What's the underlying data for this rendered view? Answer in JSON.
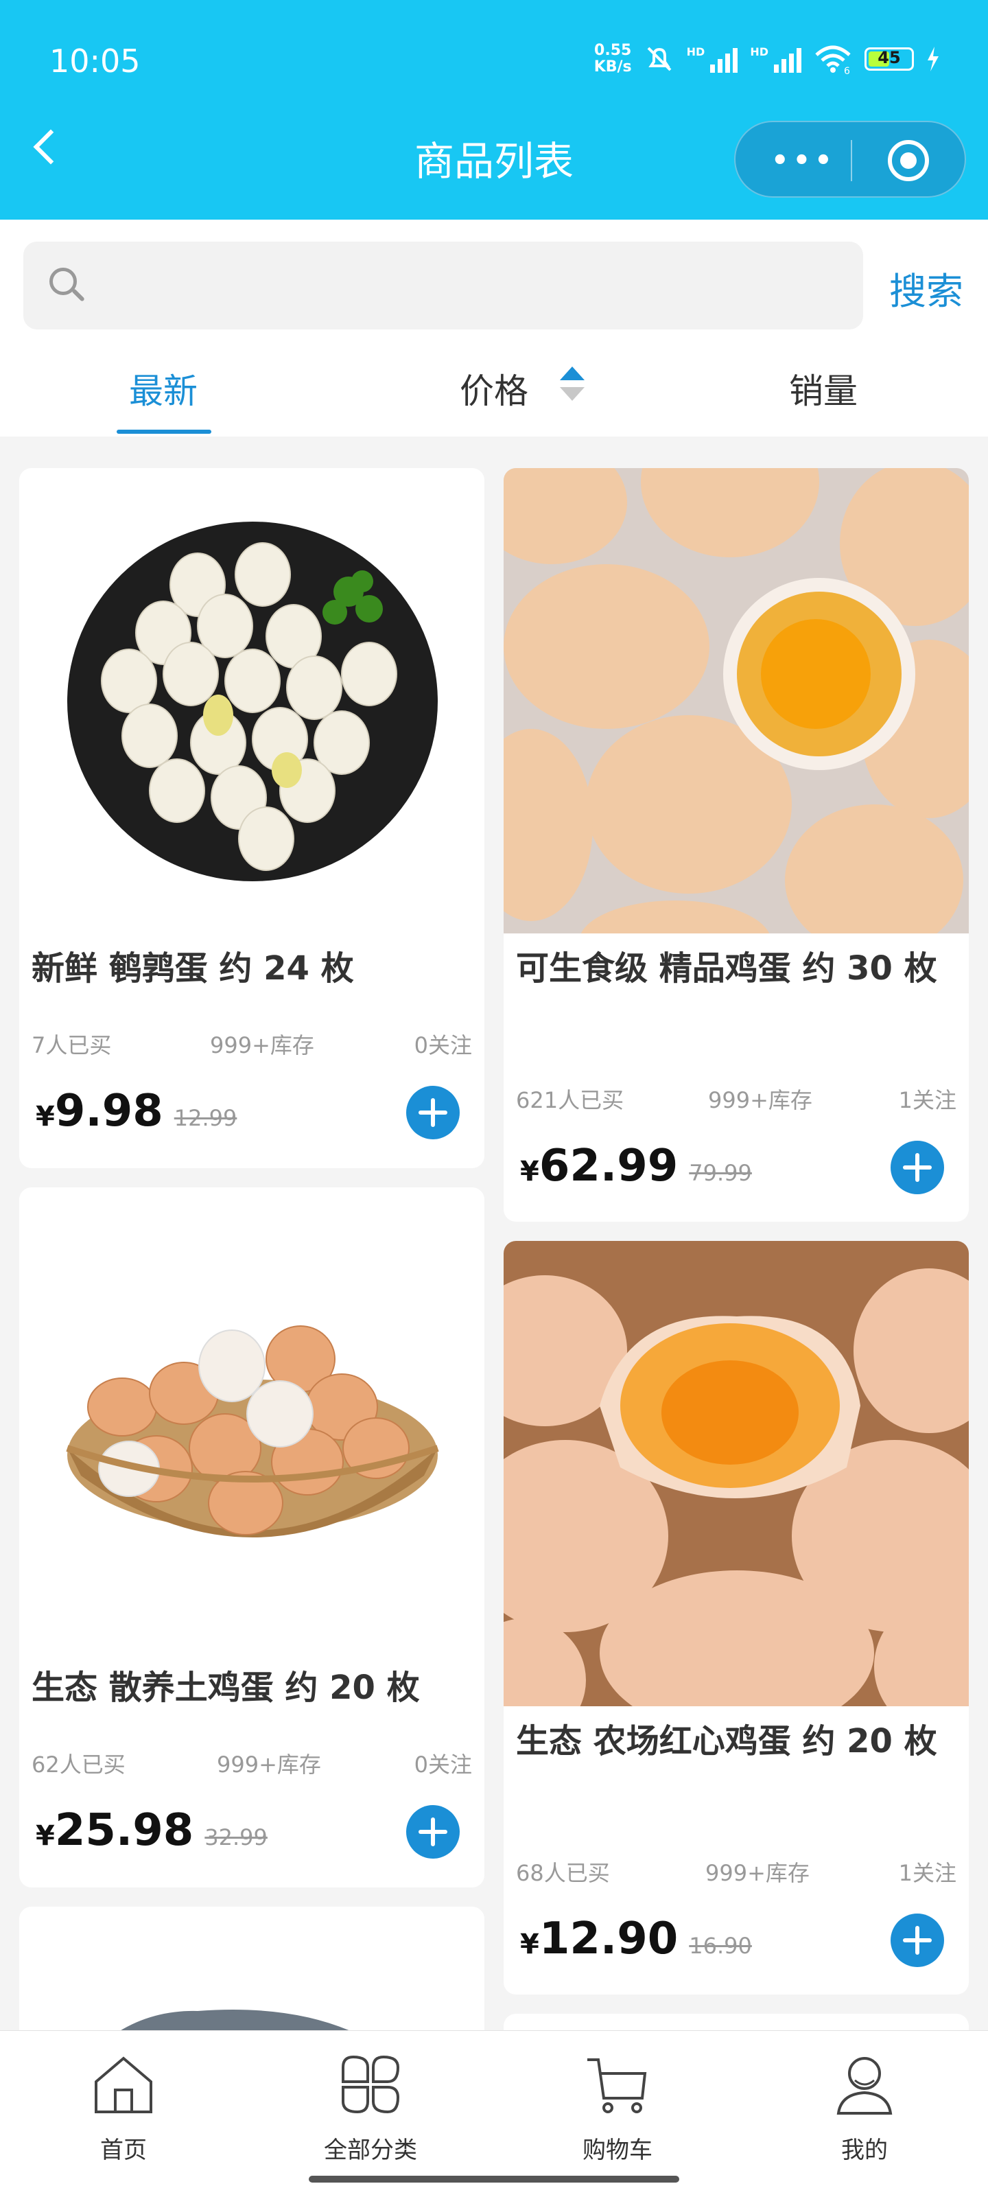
{
  "status_bar": {
    "time": "10:05",
    "net_speed_value": "0.55",
    "net_speed_unit": "KB/s",
    "signal_1_tag": "HD",
    "signal_2_tag": "HD",
    "wifi_tag": "6",
    "battery": "45"
  },
  "nav": {
    "title": "商品列表",
    "more_icon": "more-dots-icon",
    "close_icon": "target-icon"
  },
  "search": {
    "placeholder": "",
    "value": "",
    "button_label": "搜索"
  },
  "sort_tabs": [
    {
      "label": "最新",
      "active": true
    },
    {
      "label": "价格",
      "active": false
    },
    {
      "label": "销量",
      "active": false
    }
  ],
  "products": [
    {
      "name": "新鲜 鹌鹑蛋 约 24 枚",
      "bought": "7人已买",
      "stock": "999+库存",
      "follow": "0关注",
      "currency": "¥",
      "price": "9.98",
      "original_price": "12.99"
    },
    {
      "name": "可生食级 精品鸡蛋 约 30 枚",
      "bought": "621人已买",
      "stock": "999+库存",
      "follow": "1关注",
      "currency": "¥",
      "price": "62.99",
      "original_price": "79.99"
    },
    {
      "name": "生态 散养土鸡蛋 约 20 枚",
      "bought": "62人已买",
      "stock": "999+库存",
      "follow": "0关注",
      "currency": "¥",
      "price": "25.98",
      "original_price": "32.99"
    },
    {
      "name": "生态 农场红心鸡蛋 约 20 枚",
      "bought": "68人已买",
      "stock": "999+库存",
      "follow": "1关注",
      "currency": "¥",
      "price": "12.90",
      "original_price": "16.90"
    }
  ],
  "tabbar": [
    {
      "label": "首页",
      "icon": "home-icon"
    },
    {
      "label": "全部分类",
      "icon": "category-icon"
    },
    {
      "label": "购物车",
      "icon": "cart-icon"
    },
    {
      "label": "我的",
      "icon": "user-icon"
    }
  ],
  "colors": {
    "header": "#18c7f3",
    "accent": "#1b8fd6"
  }
}
